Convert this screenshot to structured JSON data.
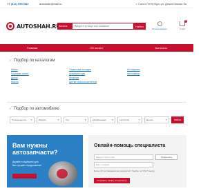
{
  "topbar": {
    "phone": "+7 (911) 0997082",
    "email": "autoshah@mail.ru",
    "city": "г. Санкт-Петербург ул. Демонтажная 8а"
  },
  "header": {
    "logo_text": "AUTOSHAH.RU",
    "search": {
      "category_label": "Каталог",
      "placeholder": "Введите артикул или название",
      "button_label": "Найти"
    },
    "cabinet_label": "Личный кабинет",
    "cart_label": "0 руб",
    "cart_count": "0"
  },
  "nav": [
    "Главная",
    "Об оплате",
    "Контакты"
  ],
  "catalog": {
    "title": "Подбор по каталогам",
    "columns": [
      [
        "Шины",
        "Грузовые шины",
        "Диски",
        "Масла"
      ],
      [
        "Тормозные колодки",
        "Аккумуляторы",
        "Фильтры",
        "Щетки стеклоочистителя"
      ],
      [
        "Антифризы",
        "Автолампы"
      ]
    ]
  },
  "car": {
    "title": "Подбор по автомобилю",
    "selects": [
      "Производитель",
      "Модель",
      "Год",
      "Модификация",
      "Категория",
      "Деталь"
    ],
    "button_label": "Найти"
  },
  "promo": {
    "heading": "Вам нужны автозапчасти?",
    "sub": "Давайте подберем для Вас лучшее предложение"
  },
  "help": {
    "heading": "Онлайн-помощь специалиста",
    "field1_placeholder": "Введите VIN-номер",
    "field1_button": "Прикрепить",
    "field2_placeholder": "Ваш телефон",
    "note": "Более 10 поставщиков автозапчастей. Подбор по VIN 15 минут.",
    "send_label": "Отправить заявку специалисту"
  }
}
